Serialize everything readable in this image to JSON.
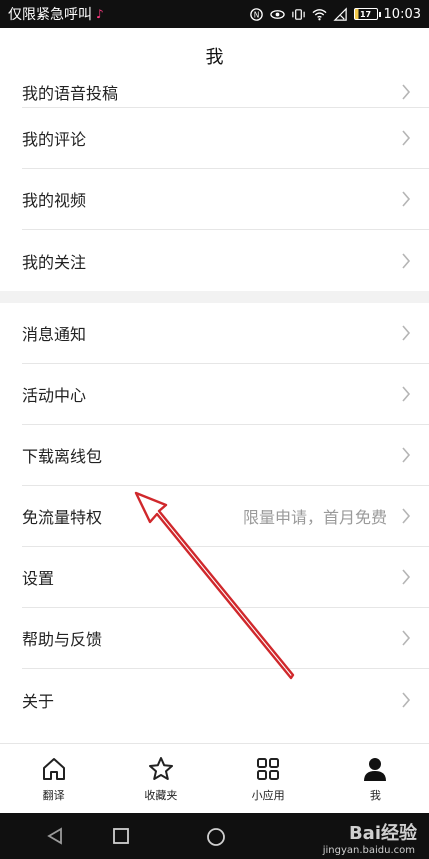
{
  "status_bar": {
    "carrier_text": "仅限紧急呼叫",
    "battery_level": "17",
    "time": "10:03"
  },
  "header": {
    "title": "我"
  },
  "menu": {
    "group1": [
      {
        "label": "我的语音投稿",
        "extra": ""
      },
      {
        "label": "我的评论",
        "extra": ""
      },
      {
        "label": "我的视频",
        "extra": ""
      },
      {
        "label": "我的关注",
        "extra": ""
      }
    ],
    "group2": [
      {
        "label": "消息通知",
        "extra": ""
      },
      {
        "label": "活动中心",
        "extra": ""
      },
      {
        "label": "下载离线包",
        "extra": ""
      },
      {
        "label": "免流量特权",
        "extra": "限量申请，首月免费"
      },
      {
        "label": "设置",
        "extra": ""
      },
      {
        "label": "帮助与反馈",
        "extra": ""
      },
      {
        "label": "关于",
        "extra": ""
      }
    ]
  },
  "bottom_nav": [
    {
      "label": "翻译",
      "icon": "home-icon"
    },
    {
      "label": "收藏夹",
      "icon": "star-icon"
    },
    {
      "label": "小应用",
      "icon": "grid-icon"
    },
    {
      "label": "我",
      "icon": "person-icon"
    }
  ],
  "watermark": {
    "text": "Bai经验",
    "sub": "jingyan.baidu.com"
  },
  "colors": {
    "arrow": "#d0282c",
    "divider": "#e6e6e6",
    "section_gap": "#f2f2f2"
  }
}
